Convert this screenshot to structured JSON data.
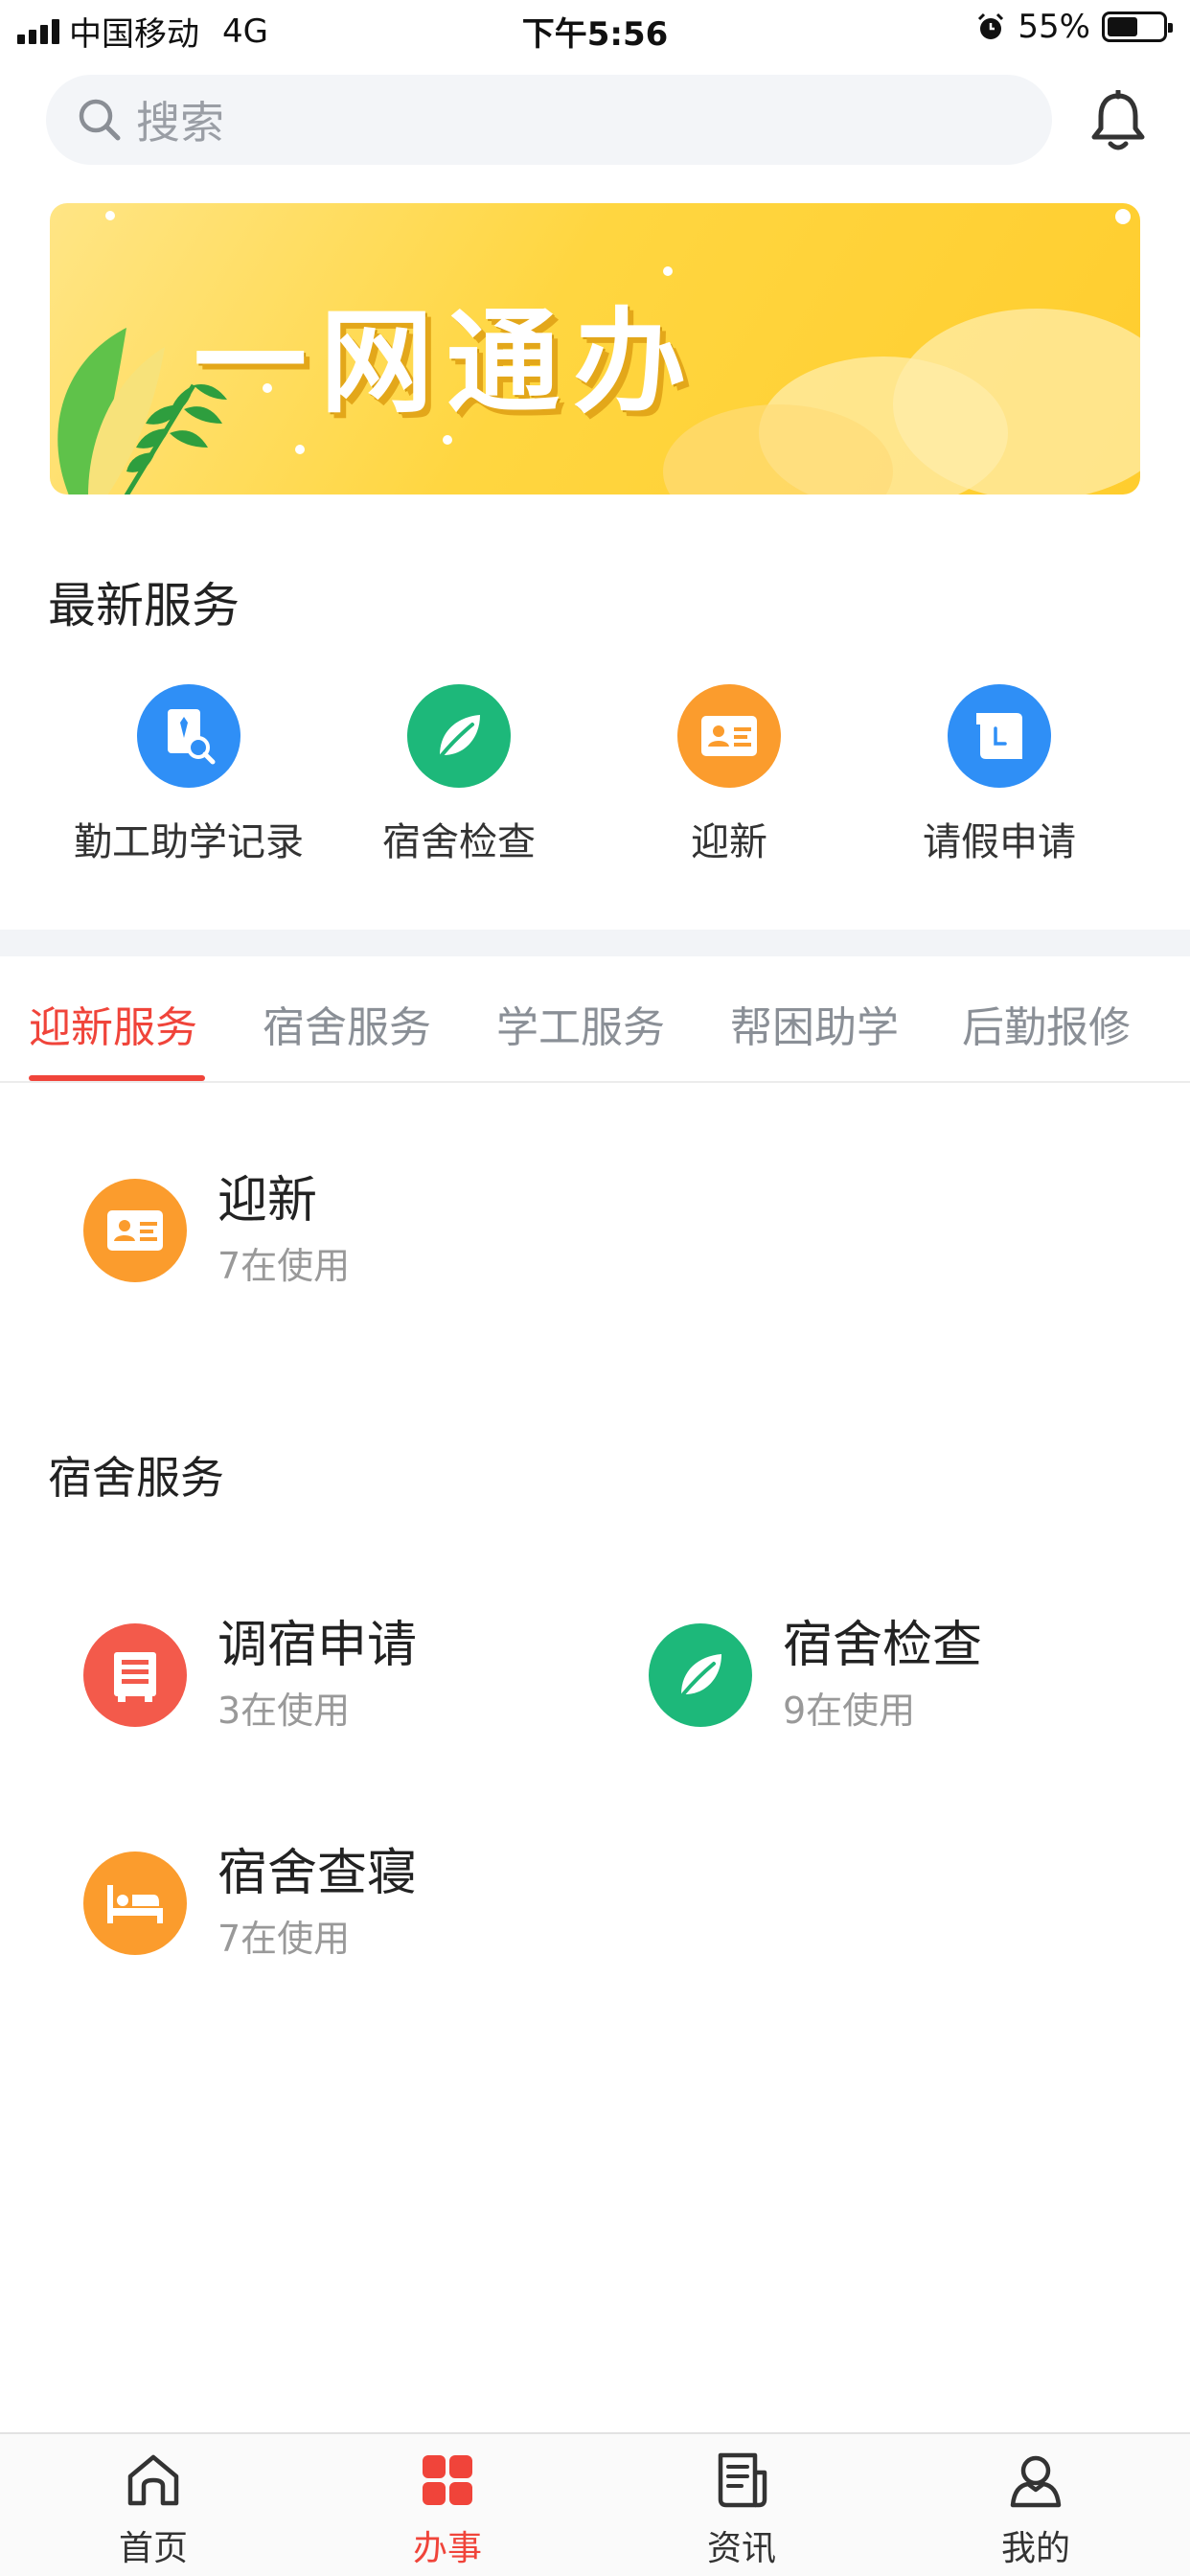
{
  "status_bar": {
    "carrier": "中国移动",
    "network": "4G",
    "time": "下午5:56",
    "battery_percent": "55%",
    "battery_level": 0.55,
    "icons": [
      "signal-bars-icon",
      "alarm-icon",
      "battery-icon"
    ]
  },
  "search": {
    "placeholder": "搜索",
    "icon": "search-icon",
    "notification_icon": "bell-icon"
  },
  "banner": {
    "title": "一网通办"
  },
  "latest_services": {
    "title": "最新服务",
    "items": [
      {
        "label": "勤工助学记录",
        "icon": "work-study-record-icon",
        "color": "#2f8ff6"
      },
      {
        "label": "宿舍检查",
        "icon": "leaf-icon",
        "color": "#1db87a"
      },
      {
        "label": "迎新",
        "icon": "id-card-icon",
        "color": "#fb9c2d"
      },
      {
        "label": "请假申请",
        "icon": "leave-scroll-icon",
        "color": "#2f8ff6"
      }
    ]
  },
  "tabs": [
    {
      "label": "迎新服务",
      "active": true
    },
    {
      "label": "宿舍服务",
      "active": false
    },
    {
      "label": "学工服务",
      "active": false
    },
    {
      "label": "帮困助学",
      "active": false
    },
    {
      "label": "后勤报修",
      "active": false
    }
  ],
  "welcome_section": {
    "items": [
      {
        "name": "迎新",
        "usage": "7在使用",
        "icon": "id-card-icon",
        "color": "#fb9c2d"
      }
    ]
  },
  "dorm_section": {
    "title": "宿舍服务",
    "items": [
      {
        "name": "调宿申请",
        "usage": "3在使用",
        "icon": "bunk-bed-icon",
        "color": "#f35a4b"
      },
      {
        "name": "宿舍检查",
        "usage": "9在使用",
        "icon": "leaf-icon",
        "color": "#1db87a"
      },
      {
        "name": "宿舍查寝",
        "usage": "7在使用",
        "icon": "bed-icon",
        "color": "#fb9c2d"
      }
    ]
  },
  "bottom_nav": [
    {
      "label": "首页",
      "icon": "home-icon",
      "active": false
    },
    {
      "label": "办事",
      "icon": "grid-icon",
      "active": true
    },
    {
      "label": "资讯",
      "icon": "news-icon",
      "active": false
    },
    {
      "label": "我的",
      "icon": "user-icon",
      "active": false
    }
  ],
  "colors": {
    "accent": "#f0443a",
    "banner_yellow": "#ffd640"
  }
}
